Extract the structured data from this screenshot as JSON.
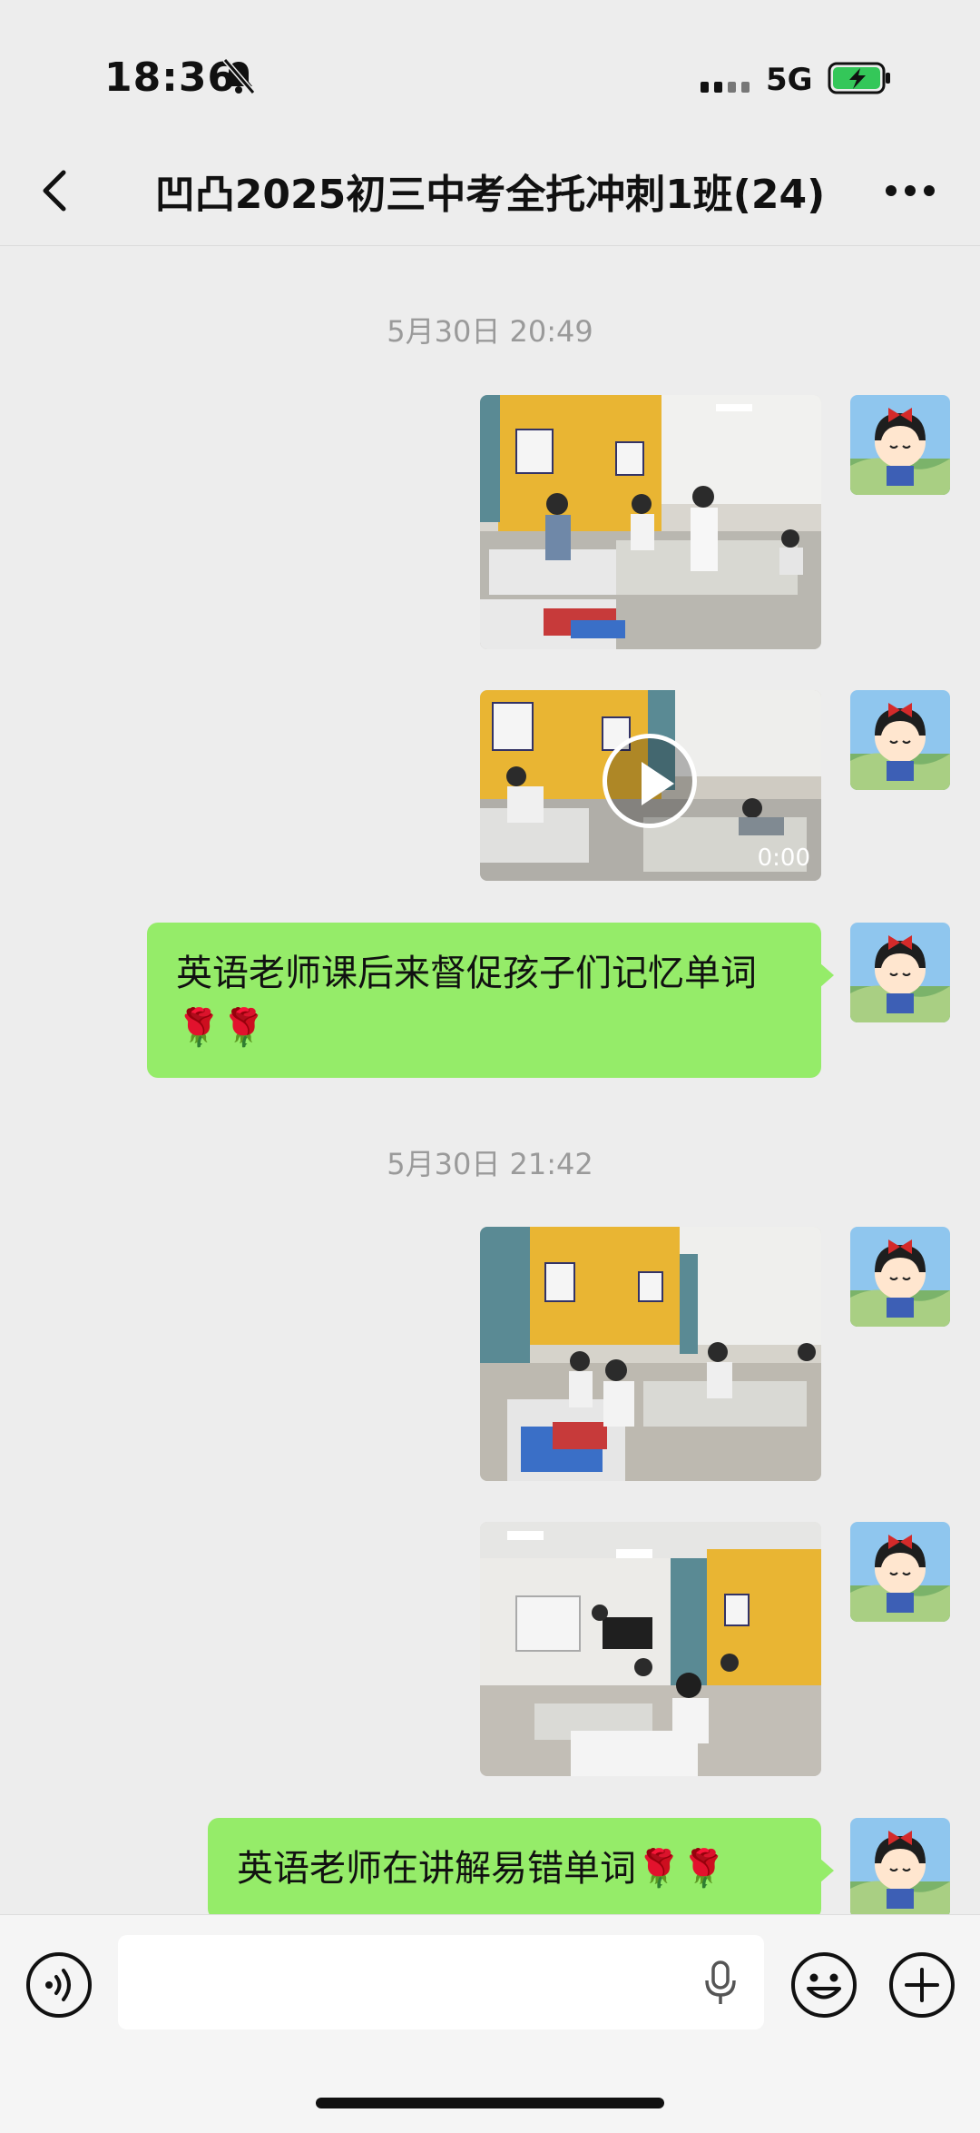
{
  "status_bar": {
    "time": "18:36",
    "network": "5G",
    "mute_icon": "bell-slash-icon",
    "battery_state": "charging"
  },
  "header": {
    "title": "凹凸2025初三中考全托冲刺1班(24)",
    "back_icon": "chevron-left-icon",
    "more_icon": "ellipsis-icon"
  },
  "chat": {
    "timestamps": [
      "5月30日 20:49",
      "5月30日 21:42"
    ],
    "video": {
      "duration": "0:00"
    },
    "messages": [
      "英语老师课后来督促孩子们记忆单词🌹🌹",
      "英语老师在讲解易错单词🌹🌹"
    ]
  },
  "input_bar": {
    "voice_icon": "voice-icon",
    "emoji_icon": "emoji-icon",
    "add_icon": "plus-icon",
    "mic_icon": "microphone-icon"
  },
  "colors": {
    "bubble": "#95ec69",
    "background": "#ededed",
    "accent": "#07c160"
  }
}
